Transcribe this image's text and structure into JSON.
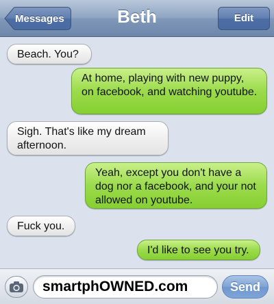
{
  "header": {
    "title": "Beth",
    "back_label": "Messages",
    "edit_label": "Edit"
  },
  "messages": [
    {
      "direction": "incoming",
      "text": "Beach. You?"
    },
    {
      "direction": "outgoing",
      "text": "At home, playing with new puppy, on facebook, and watching youtube."
    },
    {
      "direction": "incoming",
      "text": "Sigh. That's like my dream afternoon."
    },
    {
      "direction": "outgoing",
      "text": "Yeah, except you don't have a dog nor a facebook, and your not allowed on youtube."
    },
    {
      "direction": "incoming",
      "text": "Fuck you."
    },
    {
      "direction": "outgoing",
      "text": "I'd like to see you try."
    }
  ],
  "input_bar": {
    "camera_icon": "camera-icon",
    "field_text": "smartphOWNED.com",
    "send_label": "Send"
  },
  "colors": {
    "incoming_bubble": "#e8e8e8",
    "outgoing_bubble": "#9bdb4b",
    "navbar": "#8fa5c3",
    "send_button": "#7da3d6",
    "chat_background": "#dbe2ed"
  }
}
